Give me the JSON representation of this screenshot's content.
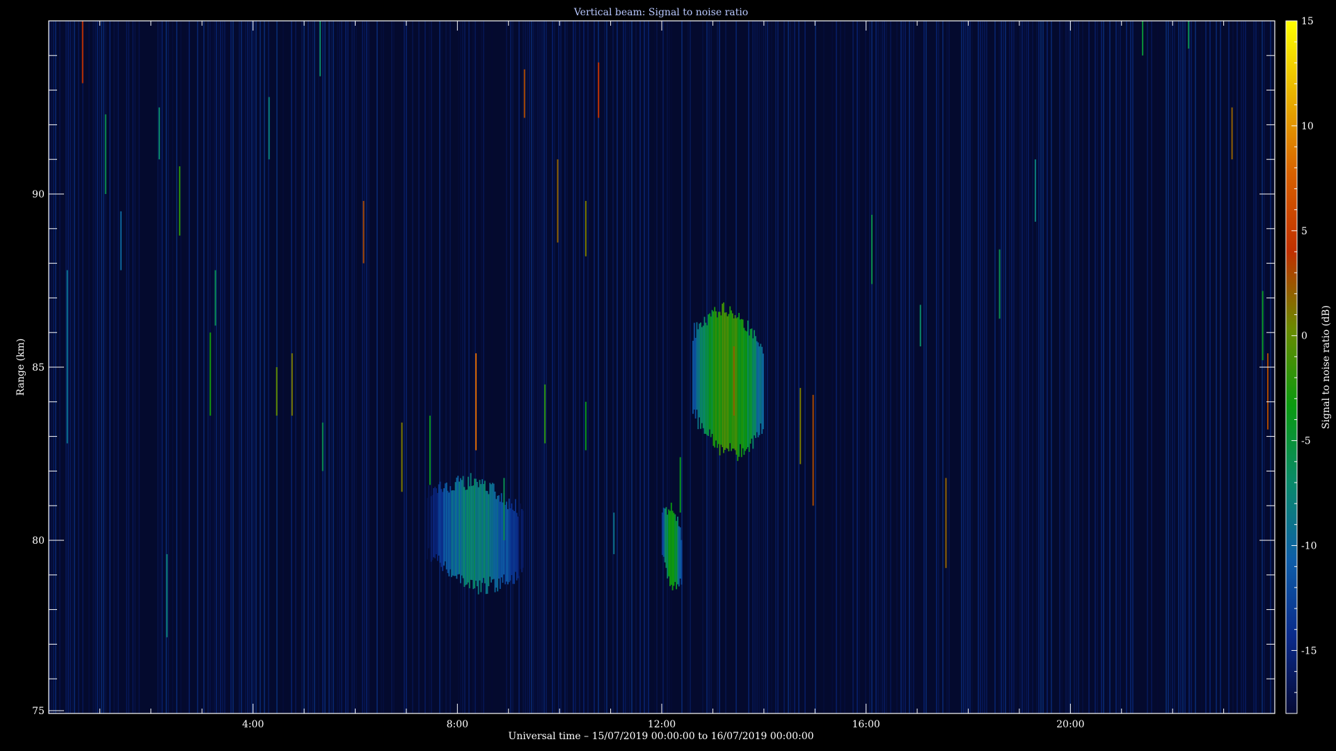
{
  "colors": {
    "background": "#000000",
    "plot_background": "#040a2e",
    "axis": "#ffffff",
    "title_text": "#b8c8ff",
    "label_text": "#ffffff",
    "colormap": [
      "#050a35",
      "#0a2a8a",
      "#0e5ea8",
      "#0a8a6a",
      "#0a9a10",
      "#6a8a00",
      "#c03000",
      "#d86000",
      "#e8b000",
      "#ffff00"
    ]
  },
  "chart_data": {
    "type": "heatmap",
    "title": "Vertical beam: Signal to noise ratio",
    "xlabel": "Universal time – 15/07/2019 00:00:00 to 16/07/2019 00:00:00",
    "ylabel": "Range (km)",
    "colorbar_label": "Signal to noise ratio (dB)",
    "x_units": "hours UT",
    "xlim": [
      0,
      24
    ],
    "ylim": [
      75,
      95
    ],
    "zlim": [
      -18,
      15
    ],
    "x_ticks": [
      {
        "value": 4,
        "label": "4:00"
      },
      {
        "value": 8,
        "label": "8:00"
      },
      {
        "value": 12,
        "label": "12:00"
      },
      {
        "value": 16,
        "label": "16:00"
      },
      {
        "value": 20,
        "label": "20:00"
      }
    ],
    "y_ticks": [
      {
        "value": 75,
        "label": "75"
      },
      {
        "value": 80,
        "label": "80"
      },
      {
        "value": 85,
        "label": "85"
      },
      {
        "value": 90,
        "label": "90"
      }
    ],
    "colorbar_ticks": [
      {
        "value": 15,
        "label": "15"
      },
      {
        "value": 10,
        "label": "10"
      },
      {
        "value": 5,
        "label": "5"
      },
      {
        "value": 0,
        "label": "0"
      },
      {
        "value": -5,
        "label": "-5"
      },
      {
        "value": -10,
        "label": "-10"
      },
      {
        "value": -15,
        "label": "-15"
      }
    ],
    "background_snr": -17,
    "echoes": [
      {
        "time_start": 7.4,
        "time_end": 9.3,
        "range_low": 78.6,
        "range_high": 81.8,
        "snr_max": -6
      },
      {
        "time_start": 12.0,
        "time_end": 12.4,
        "range_low": 78.6,
        "range_high": 81.0,
        "snr_max": -2
      },
      {
        "time_start": 12.6,
        "time_end": 14.0,
        "range_low": 82.4,
        "range_high": 86.8,
        "snr_max": 0
      }
    ],
    "streaks": [
      {
        "x": 0.35,
        "y0": 82.8,
        "y1": 87.8,
        "snr": -9
      },
      {
        "x": 0.65,
        "y0": 93.2,
        "y1": 95.0,
        "snr": 4
      },
      {
        "x": 1.1,
        "y0": 90.0,
        "y1": 92.3,
        "snr": -6
      },
      {
        "x": 1.4,
        "y0": 87.8,
        "y1": 89.5,
        "snr": -10
      },
      {
        "x": 2.15,
        "y0": 91.0,
        "y1": 92.5,
        "snr": -7
      },
      {
        "x": 2.3,
        "y0": 77.2,
        "y1": 79.6,
        "snr": -8
      },
      {
        "x": 2.55,
        "y0": 88.8,
        "y1": 90.8,
        "snr": -2
      },
      {
        "x": 3.15,
        "y0": 83.6,
        "y1": 86.0,
        "snr": -3
      },
      {
        "x": 3.25,
        "y0": 86.2,
        "y1": 87.8,
        "snr": -6
      },
      {
        "x": 4.3,
        "y0": 91.0,
        "y1": 92.8,
        "snr": -8
      },
      {
        "x": 4.45,
        "y0": 83.6,
        "y1": 85.0,
        "snr": 0
      },
      {
        "x": 4.75,
        "y0": 83.6,
        "y1": 85.4,
        "snr": 1
      },
      {
        "x": 5.3,
        "y0": 93.4,
        "y1": 95.0,
        "snr": -7
      },
      {
        "x": 5.35,
        "y0": 82.0,
        "y1": 83.4,
        "snr": -6
      },
      {
        "x": 6.15,
        "y0": 88.0,
        "y1": 89.8,
        "snr": 3
      },
      {
        "x": 6.9,
        "y0": 81.4,
        "y1": 83.4,
        "snr": 1
      },
      {
        "x": 7.45,
        "y0": 81.6,
        "y1": 83.6,
        "snr": -4
      },
      {
        "x": 8.35,
        "y0": 82.6,
        "y1": 85.4,
        "snr": 8
      },
      {
        "x": 8.9,
        "y0": 80.0,
        "y1": 81.8,
        "snr": -6
      },
      {
        "x": 9.3,
        "y0": 92.2,
        "y1": 93.6,
        "snr": 3
      },
      {
        "x": 9.7,
        "y0": 82.8,
        "y1": 84.5,
        "snr": -2
      },
      {
        "x": 9.95,
        "y0": 88.6,
        "y1": 91.0,
        "snr": 2
      },
      {
        "x": 10.5,
        "y0": 88.2,
        "y1": 89.8,
        "snr": 1
      },
      {
        "x": 10.5,
        "y0": 82.6,
        "y1": 84.0,
        "snr": -4
      },
      {
        "x": 10.75,
        "y0": 92.2,
        "y1": 93.8,
        "snr": 4
      },
      {
        "x": 11.05,
        "y0": 79.6,
        "y1": 80.8,
        "snr": -9
      },
      {
        "x": 12.35,
        "y0": 80.8,
        "y1": 82.4,
        "snr": -4
      },
      {
        "x": 13.4,
        "y0": 83.6,
        "y1": 85.6,
        "snr": 2
      },
      {
        "x": 14.7,
        "y0": 82.2,
        "y1": 84.4,
        "snr": 1
      },
      {
        "x": 14.95,
        "y0": 81.0,
        "y1": 84.2,
        "snr": 3
      },
      {
        "x": 16.1,
        "y0": 87.4,
        "y1": 89.4,
        "snr": -6
      },
      {
        "x": 17.05,
        "y0": 85.6,
        "y1": 86.8,
        "snr": -7
      },
      {
        "x": 17.55,
        "y0": 79.2,
        "y1": 81.8,
        "snr": 2
      },
      {
        "x": 18.6,
        "y0": 86.4,
        "y1": 88.4,
        "snr": -6
      },
      {
        "x": 19.3,
        "y0": 89.2,
        "y1": 91.0,
        "snr": -8
      },
      {
        "x": 21.4,
        "y0": 94.0,
        "y1": 95.0,
        "snr": -5
      },
      {
        "x": 22.3,
        "y0": 94.2,
        "y1": 95.0,
        "snr": -6
      },
      {
        "x": 23.15,
        "y0": 91.0,
        "y1": 92.5,
        "snr": 2
      },
      {
        "x": 23.75,
        "y0": 85.2,
        "y1": 87.2,
        "snr": -4
      },
      {
        "x": 23.85,
        "y0": 83.2,
        "y1": 85.4,
        "snr": 3
      }
    ]
  }
}
